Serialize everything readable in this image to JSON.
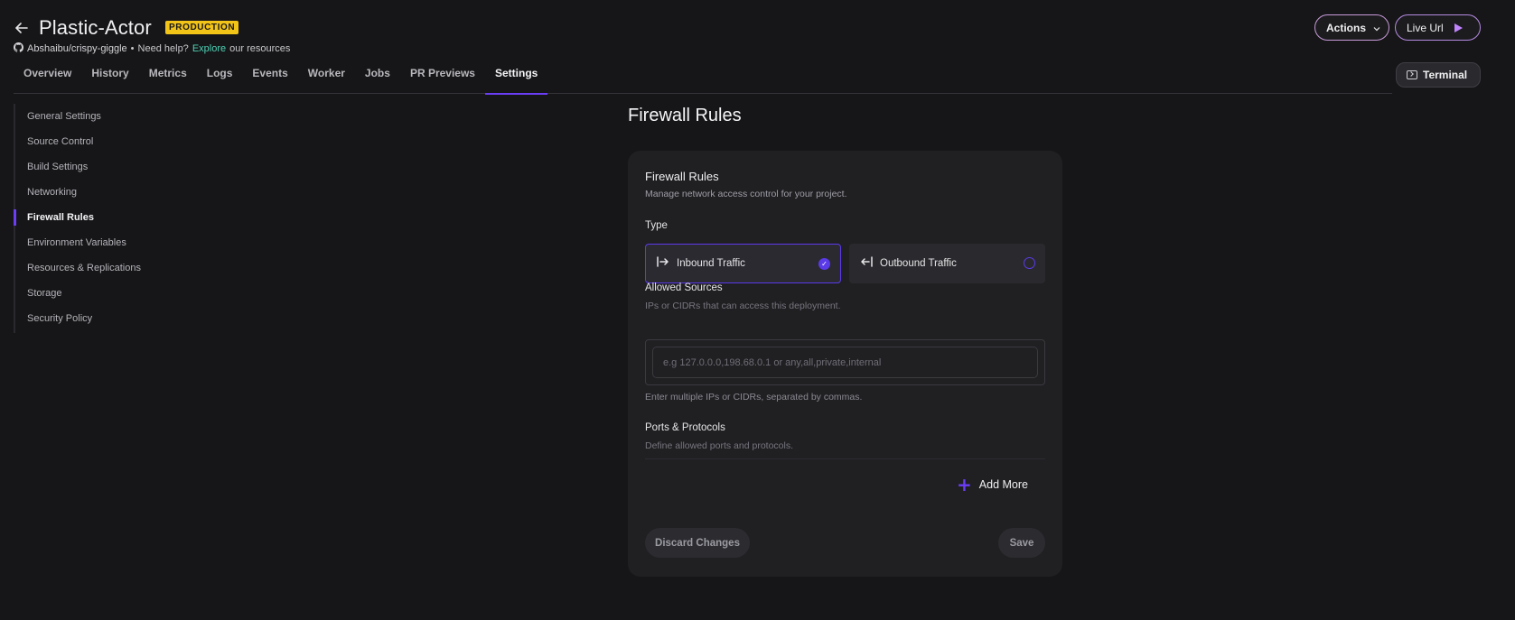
{
  "header": {
    "title": "Plastic-Actor",
    "env_badge": "PRODUCTION",
    "repo": "Abshaibu/crispy-giggle",
    "separator": "•",
    "help_prefix": "Need help?",
    "help_link": "Explore",
    "help_suffix": "our resources",
    "actions_label": "Actions",
    "live_url_label": "Live Url"
  },
  "tabs": [
    {
      "label": "Overview"
    },
    {
      "label": "History"
    },
    {
      "label": "Metrics"
    },
    {
      "label": "Logs"
    },
    {
      "label": "Events"
    },
    {
      "label": "Worker"
    },
    {
      "label": "Jobs"
    },
    {
      "label": "PR Previews"
    },
    {
      "label": "Settings",
      "active": true
    }
  ],
  "terminal_label": "Terminal",
  "sidebar": {
    "items": [
      {
        "label": "General Settings"
      },
      {
        "label": "Source Control"
      },
      {
        "label": "Build Settings"
      },
      {
        "label": "Networking"
      },
      {
        "label": "Firewall Rules",
        "active": true
      },
      {
        "label": "Environment Variables"
      },
      {
        "label": "Resources & Replications"
      },
      {
        "label": "Storage"
      },
      {
        "label": "Security Policy"
      }
    ]
  },
  "main": {
    "page_title": "Firewall Rules",
    "card": {
      "title": "Firewall Rules",
      "description": "Manage network access control for your project.",
      "type_label": "Type",
      "options": {
        "inbound": {
          "label": "Inbound Traffic",
          "selected": true
        },
        "outbound": {
          "label": "Outbound Traffic",
          "selected": false
        }
      },
      "allowed_sources": {
        "label": "Allowed Sources",
        "description": "IPs or CIDRs that can access this deployment.",
        "value": "",
        "placeholder": "e.g 127.0.0.0,198.68.0.1 or any,all,private,internal",
        "hint": "Enter multiple IPs or CIDRs, separated by commas."
      },
      "ports": {
        "label": "Ports & Protocols",
        "description": "Define allowed ports and protocols."
      },
      "add_more_label": "Add More",
      "discard_label": "Discard Changes",
      "save_label": "Save"
    }
  },
  "colors": {
    "accent": "#6b3df5",
    "badge": "#f2c418",
    "link": "#4fd1b5",
    "background": "#161618",
    "card": "#202023"
  }
}
